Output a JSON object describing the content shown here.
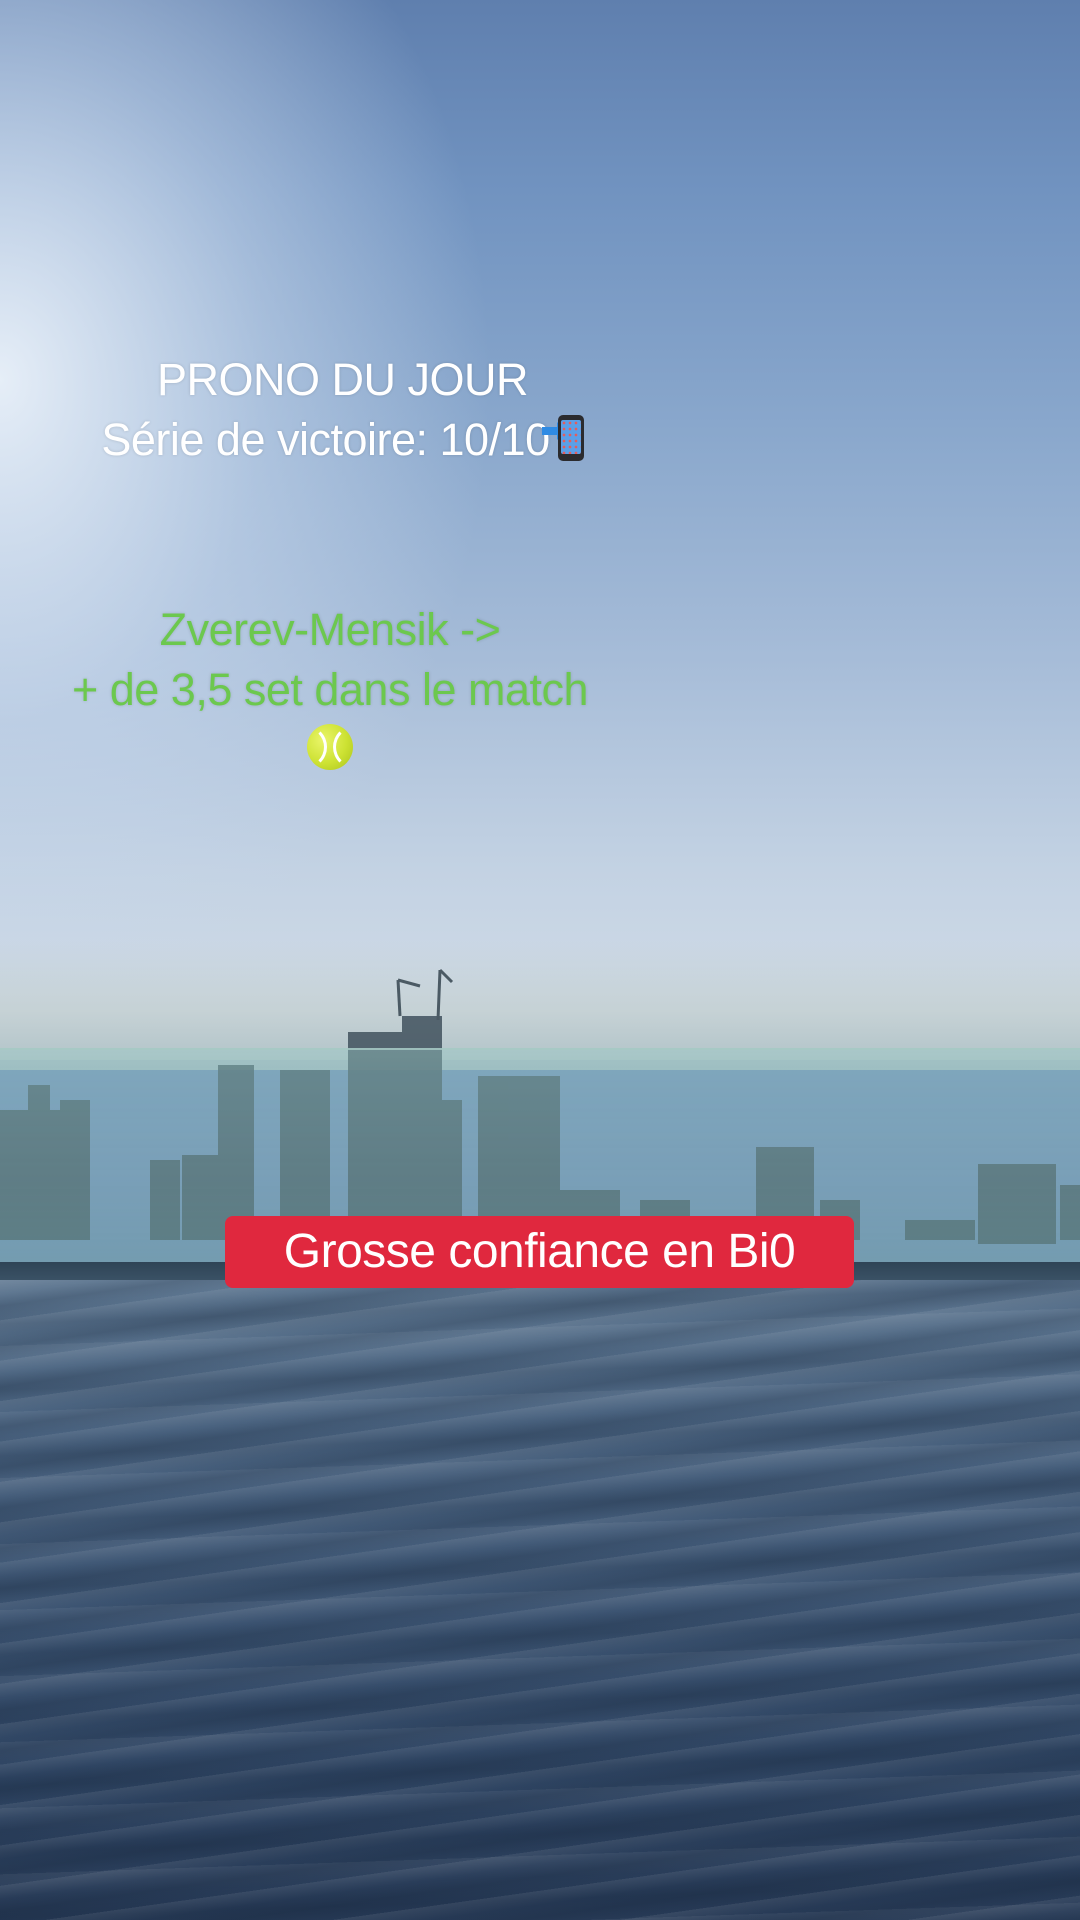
{
  "overlay": {
    "headline_line1": "PRONO DU JOUR",
    "headline_line2": "Série de victoire: 10/10",
    "headline_emoji": "mobile-phone-with-arrow-icon",
    "pick_line1": "Zverev-Mensik ->",
    "pick_line2": "+ de 3,5 set dans le match",
    "pick_emoji": "tennis-ball-icon",
    "cta_label": "Grosse confiance en Bi0"
  },
  "colors": {
    "headline_text": "#ffffff",
    "pick_text": "#6cc84e",
    "cta_background": "#e0283e",
    "cta_text": "#ffffff"
  }
}
